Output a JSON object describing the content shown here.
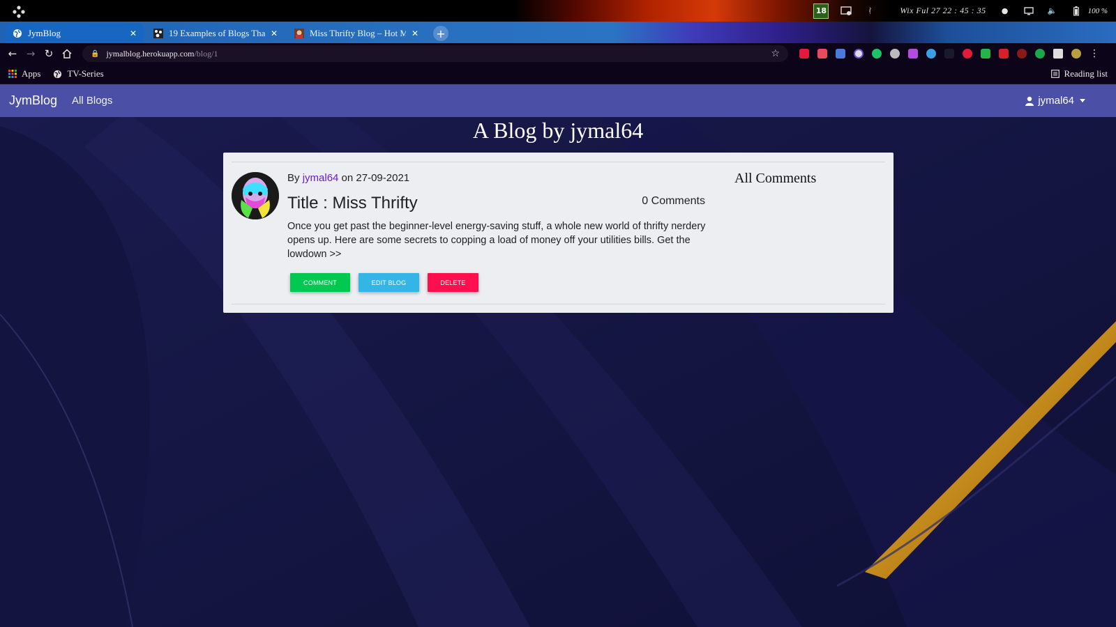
{
  "os": {
    "clock": "Wix Ful 27  22 : 45 : 35",
    "battery": "100 %",
    "badge": "18"
  },
  "browser": {
    "tabs": [
      {
        "title": "JymBlog",
        "active": true
      },
      {
        "title": "19 Examples of Blogs That",
        "active": false
      },
      {
        "title": "Miss Thrifty Blog – Hot Mo",
        "active": false
      }
    ],
    "url_host": "jymalblog.herokuapp.com",
    "url_path": "/blog/1",
    "bookmarks": [
      {
        "label": "Apps",
        "icon": "apps-grid-icon"
      },
      {
        "label": "TV-Series",
        "icon": "globe-icon"
      }
    ],
    "reading_list": "Reading list"
  },
  "navbar": {
    "brand": "JymBlog",
    "all_blogs": "All Blogs",
    "username": "jymal64"
  },
  "page": {
    "heading": "A Blog by jymal64"
  },
  "post": {
    "by": "By",
    "author": "jymal64",
    "on": "on 27-09-2021",
    "title": "Title : Miss Thrifty",
    "comment_count": "0 Comments",
    "body": "Once you get past the beginner-level energy-saving stuff, a whole new world of thrifty nerdery opens up. Here are some secrets to copping a load of money off your utilities bills. Get the lowdown >>",
    "buttons": {
      "comment": "COMMENT",
      "edit": "EDIT BLOG",
      "delete": "DELETE"
    }
  },
  "comments": {
    "heading": "All Comments"
  },
  "colors": {
    "navbar": "#4b4fa6",
    "comment_button": "#00c851",
    "edit_button": "#33b5e5",
    "delete_button": "#ff0f4d",
    "author_link": "#6a1bd6"
  }
}
